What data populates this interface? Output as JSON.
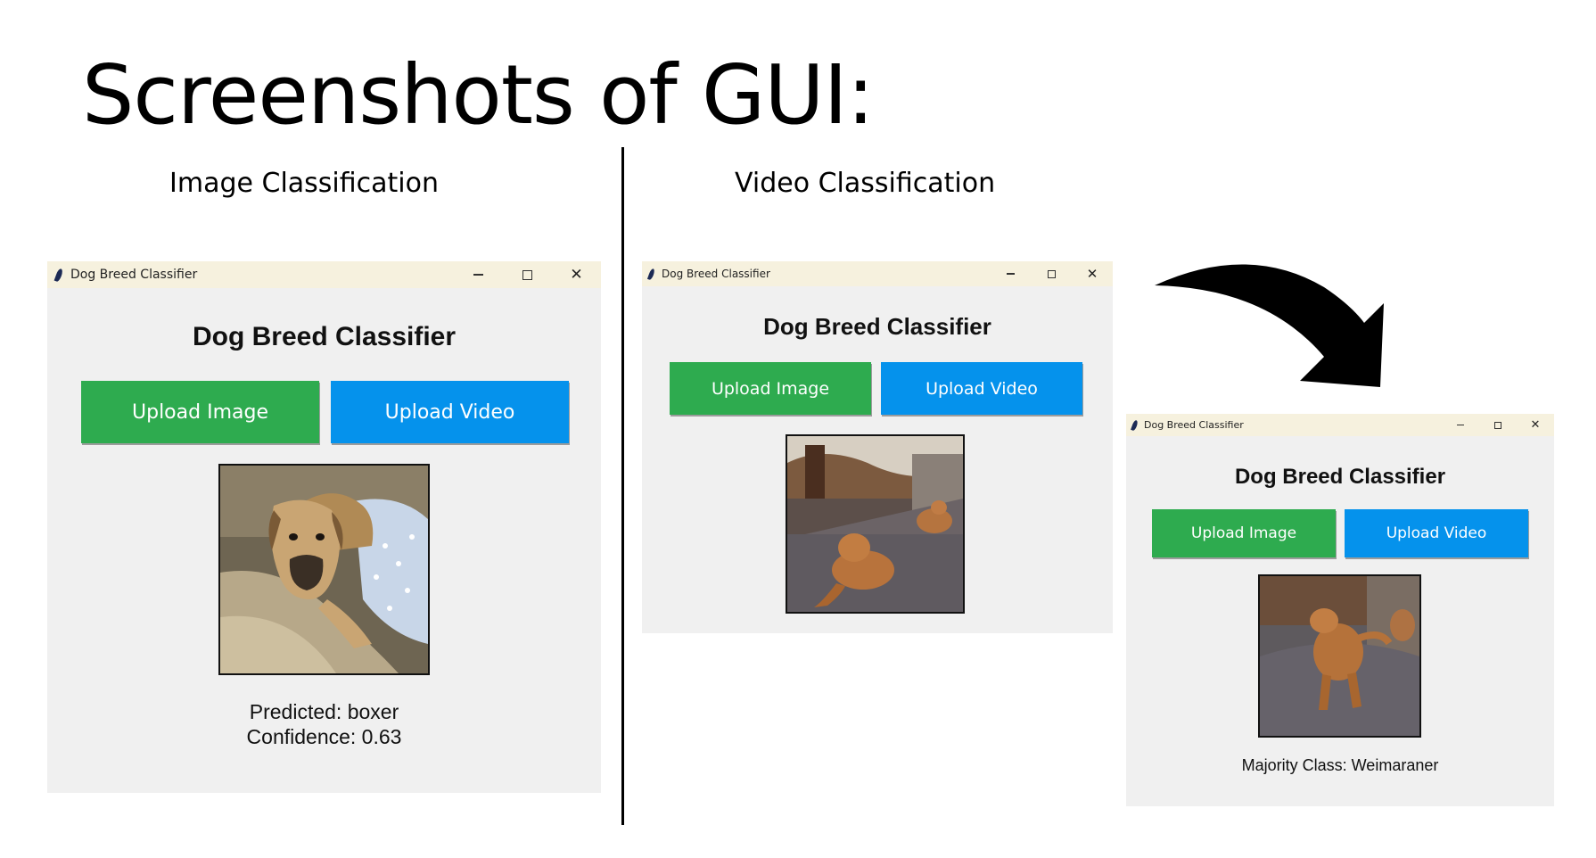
{
  "slide": {
    "title": "Screenshots of GUI:",
    "section_image": "Image Classification",
    "section_video": "Video Classification"
  },
  "windows": [
    {
      "title": "Dog Breed Classifier",
      "heading": "Dog Breed Classifier",
      "upload_image": "Upload Image",
      "upload_video": "Upload Video",
      "result_line1": "Predicted: boxer",
      "result_line2": "Confidence: 0.63"
    },
    {
      "title": "Dog Breed Classifier",
      "heading": "Dog Breed Classifier",
      "upload_image": "Upload Image",
      "upload_video": "Upload Video"
    },
    {
      "title": "Dog Breed Classifier",
      "heading": "Dog Breed Classifier",
      "upload_image": "Upload Image",
      "upload_video": "Upload Video",
      "result_line1": "Majority Class: Weimaraner"
    }
  ],
  "window_controls": {
    "minimize_glyph": "minimize-icon",
    "maximize_glyph": "maximize-icon",
    "close_glyph": "✕"
  },
  "colors": {
    "upload_image_button": "#2eab4f",
    "upload_video_button": "#0592ec",
    "titlebar": "#f6f1de",
    "window_background": "#f0f0f0"
  }
}
